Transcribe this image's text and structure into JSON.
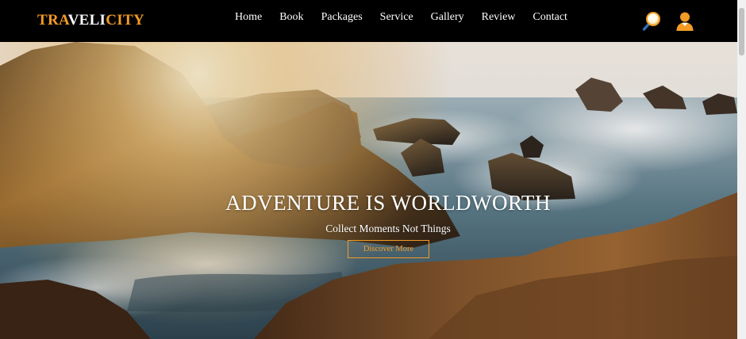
{
  "brand": {
    "logo_part1": "TRA",
    "logo_part2": "VELI",
    "logo_part3": "CITY"
  },
  "nav": {
    "items": [
      {
        "label": "Home"
      },
      {
        "label": "Book"
      },
      {
        "label": "Packages"
      },
      {
        "label": "Service"
      },
      {
        "label": "Gallery"
      },
      {
        "label": "Review"
      },
      {
        "label": "Contact"
      }
    ],
    "icons": [
      "search-icon",
      "user-icon"
    ]
  },
  "hero": {
    "title": "ADVENTURE IS WORLDWORTH",
    "subtitle": "Collect Moments Not Things",
    "cta_label": "Discover More"
  },
  "colors": {
    "accent": "#f29b25",
    "header_bg": "#000000",
    "text": "#ffffff"
  }
}
